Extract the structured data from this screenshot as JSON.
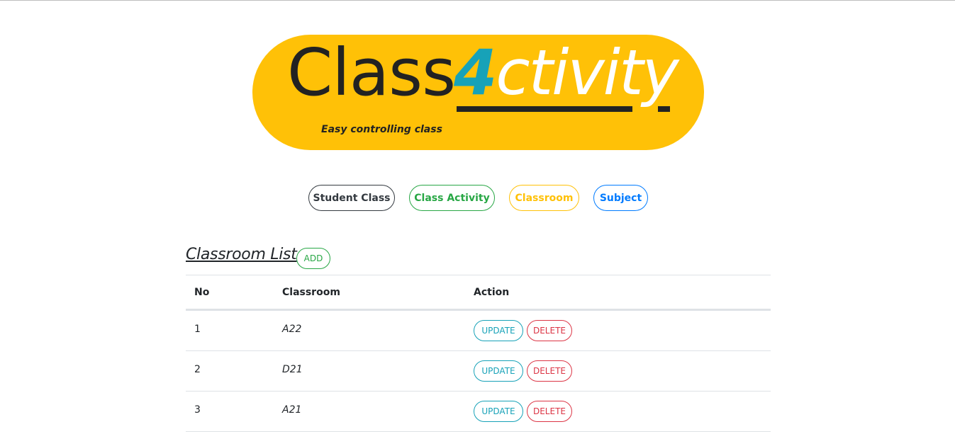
{
  "logo": {
    "word_class": "Class",
    "word_four": "4",
    "word_ctivity": "ctivity",
    "tagline": "Easy controlling class",
    "bg_color": "#ffc107"
  },
  "nav": {
    "items": [
      {
        "label": "Student Class",
        "color": "#343a40"
      },
      {
        "label": "Class Activity",
        "color": "#28a745"
      },
      {
        "label": "Classroom",
        "color": "#ffc107"
      },
      {
        "label": "Subject",
        "color": "#007bff"
      }
    ]
  },
  "section": {
    "title": "Classroom List",
    "add_label": "ADD"
  },
  "table": {
    "headers": [
      "No",
      "Classroom",
      "Action"
    ],
    "rows": [
      {
        "no": "1",
        "classroom": "A22"
      },
      {
        "no": "2",
        "classroom": "D21"
      },
      {
        "no": "3",
        "classroom": "A21"
      }
    ],
    "update_label": "UPDATE",
    "delete_label": "DELETE"
  }
}
